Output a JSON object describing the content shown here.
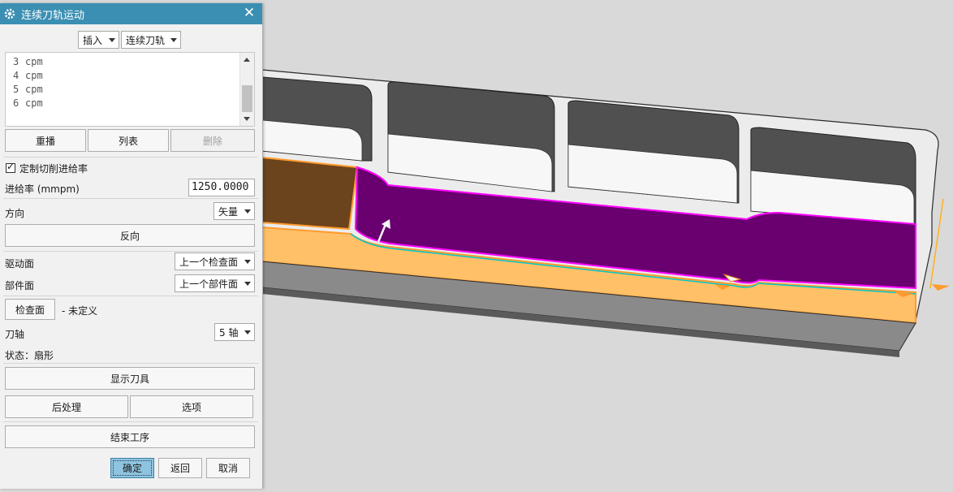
{
  "dialog": {
    "title": "连续刀轨运动",
    "icon": "gear-icon",
    "close_label": "✕",
    "insert_dropdown": "插入",
    "type_dropdown": "连续刀轨",
    "list": [
      {
        "num": "3",
        "text": "cpm"
      },
      {
        "num": "4",
        "text": "cpm"
      },
      {
        "num": "5",
        "text": "cpm"
      },
      {
        "num": "6",
        "text": "cpm"
      }
    ],
    "replay_button": "重播",
    "list_button": "列表",
    "delete_button": "删除",
    "custom_feed_checkbox": "定制切削进给率",
    "custom_feed_checked": true,
    "feed_label": "进给率 (mmpm)",
    "feed_value": "1250.0000",
    "direction_label": "方向",
    "direction_value": "矢量",
    "reverse_button": "反向",
    "drive_label": "驱动面",
    "drive_value": "上一个检查面",
    "part_label": "部件面",
    "part_value": "上一个部件面",
    "check_button": "检查面",
    "check_status": "- 未定义",
    "axis_label": "刀轴",
    "axis_value": "5 轴",
    "status_text": "状态：扇形",
    "show_tool_button": "显示刀具",
    "post_button": "后处理",
    "options_button": "选项",
    "end_button": "结束工序",
    "ok_button": "确定",
    "back_button": "返回",
    "cancel_button": "取消"
  },
  "colors": {
    "title_bar": "#3b8fb3",
    "viewport_bg": "#d9d9d9",
    "face_orange": "#ffc067",
    "face_purple": "#6a0070",
    "highlight_magenta": "#ff00ff",
    "toolpath_cyan": "#00c8c8"
  }
}
